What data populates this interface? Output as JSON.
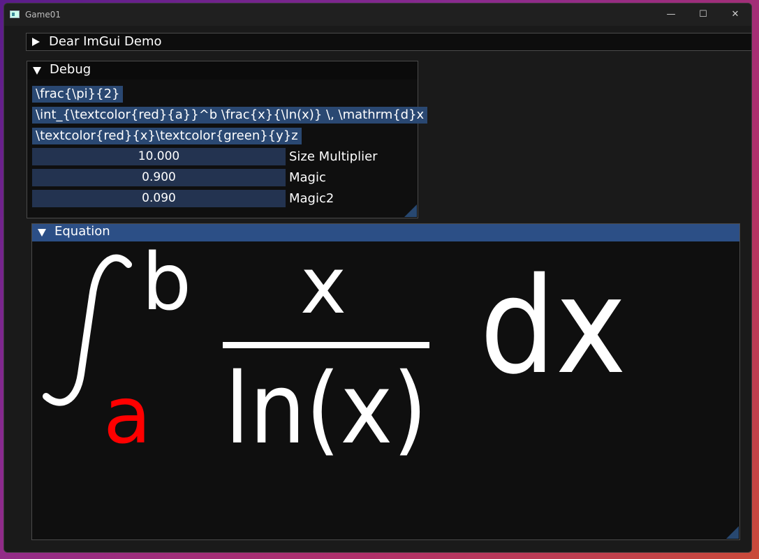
{
  "window": {
    "title": "Game01",
    "controls": {
      "minimize": "—",
      "maximize": "☐",
      "close": "✕"
    }
  },
  "demo_window": {
    "title": "Dear ImGui Demo",
    "collapsed": true
  },
  "debug_window": {
    "title": "Debug",
    "text_inputs": [
      "\\frac{\\pi}{2}",
      "\\int_{\\textcolor{red}{a}}^b \\frac{x}{\\ln(x)} \\, \\mathrm{d}x",
      "\\textcolor{red}{x}\\textcolor{green}{y}z"
    ],
    "sliders": [
      {
        "value": "10.000",
        "label": "Size Multiplier"
      },
      {
        "value": "0.900",
        "label": "Magic"
      },
      {
        "value": "0.090",
        "label": "Magic2"
      }
    ]
  },
  "equation_window": {
    "title": "Equation",
    "render": {
      "upper_limit": "b",
      "lower_limit": "a",
      "numerator": "x",
      "denominator": "ln(x)",
      "differential": "dx",
      "text_color": "#ffffff",
      "highlight_color": "#ff0000"
    }
  },
  "colors": {
    "text_input_bg": "#2a4872",
    "slider_bg": "#233350",
    "active_title": "#2c4f86"
  }
}
